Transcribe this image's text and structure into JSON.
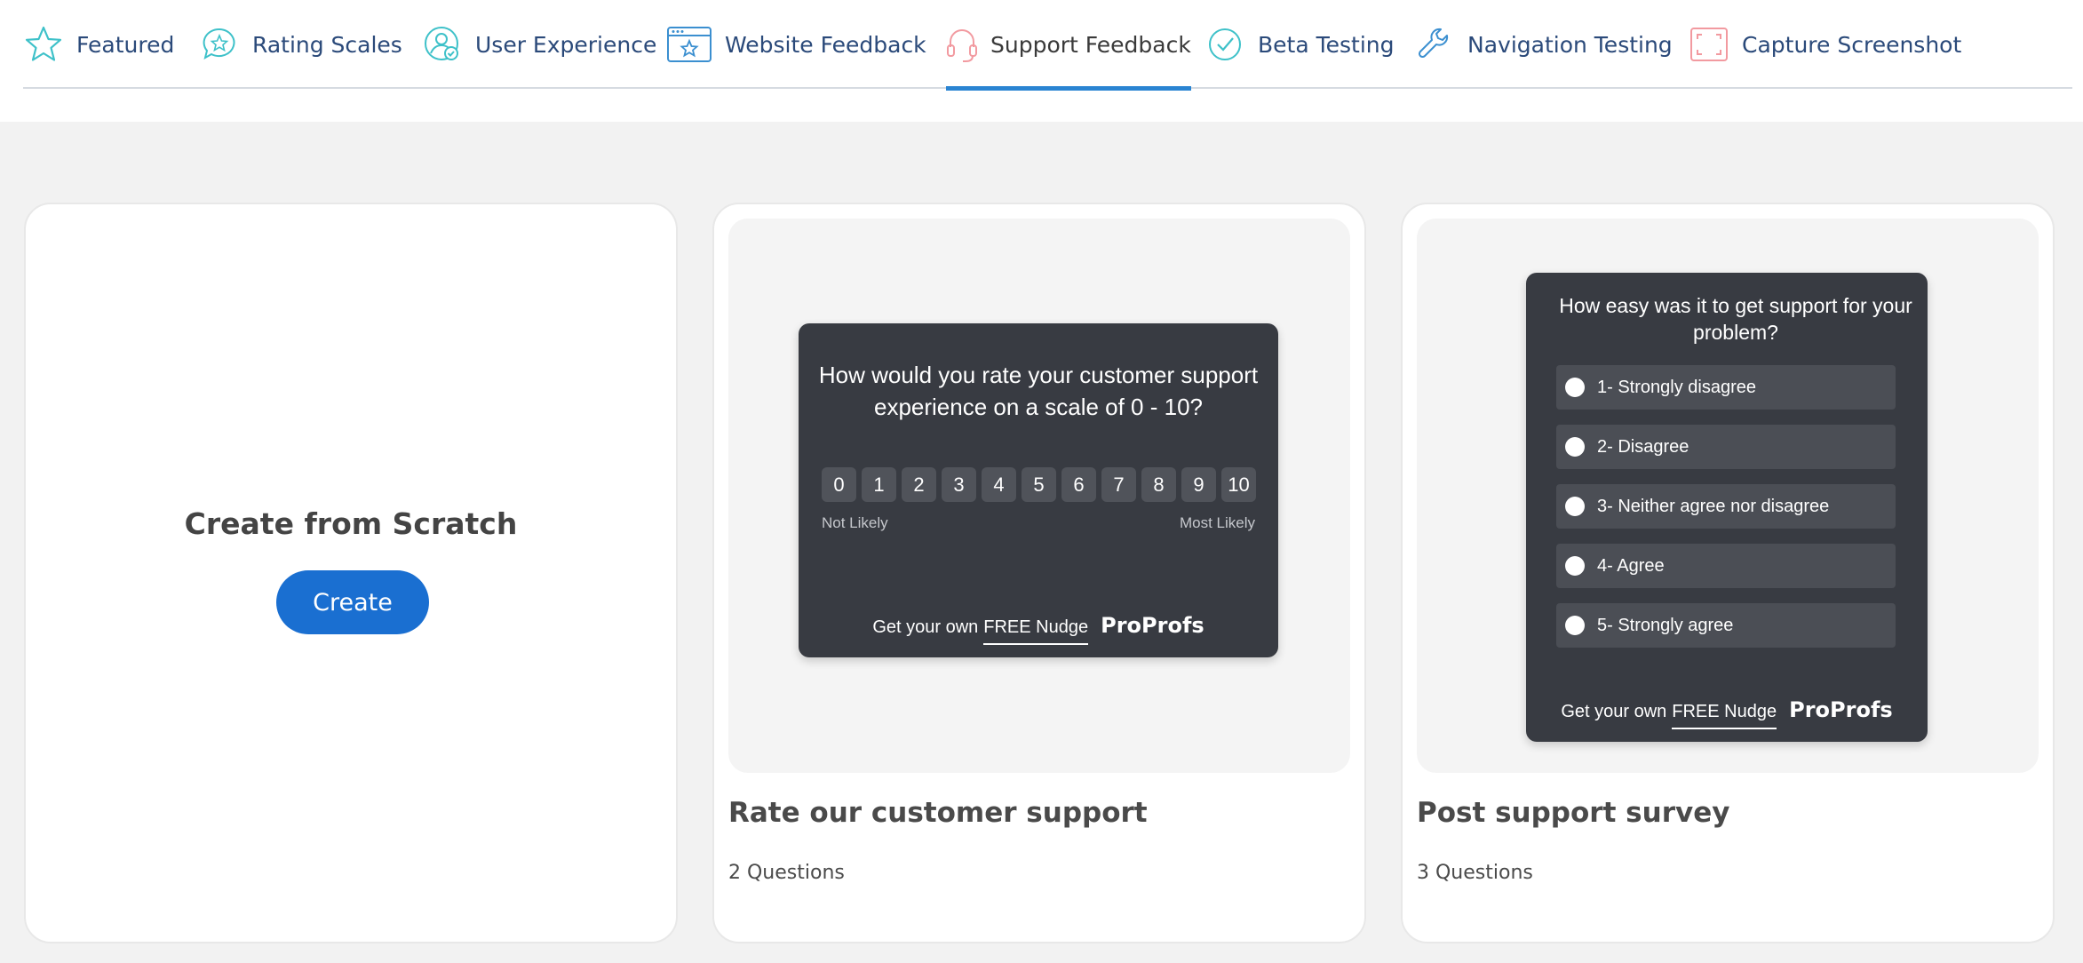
{
  "tabs": [
    {
      "label": "Featured",
      "icon": "star-icon"
    },
    {
      "label": "Rating Scales",
      "icon": "rating-bubble-icon"
    },
    {
      "label": "User Experience",
      "icon": "user-check-icon"
    },
    {
      "label": "Website Feedback",
      "icon": "browser-star-icon"
    },
    {
      "label": "Support Feedback",
      "icon": "headset-icon",
      "active": true
    },
    {
      "label": "Beta Testing",
      "icon": "check-circle-icon"
    },
    {
      "label": "Navigation Testing",
      "icon": "wrench-icon"
    },
    {
      "label": "Capture Screenshot",
      "icon": "screenshot-frame-icon"
    }
  ],
  "colors": {
    "accent": "#2a84d2",
    "tab_text": "#2b4a7a",
    "create_button": "#1a6fd1",
    "widget_bg": "#383b42"
  },
  "scratch": {
    "title": "Create from Scratch",
    "button_label": "Create"
  },
  "rate_card": {
    "title": "Rate our customer support",
    "subtitle": "2 Questions",
    "widget": {
      "question": "How would you rate your customer support experience on a scale of 0 - 10?",
      "scale": [
        "0",
        "1",
        "2",
        "3",
        "4",
        "5",
        "6",
        "7",
        "8",
        "9",
        "10"
      ],
      "label_low": "Not Likely",
      "label_high": "Most Likely",
      "footer_text": "Get your own",
      "footer_link": "FREE Nudge",
      "brand": "ProProfs"
    }
  },
  "post_card": {
    "title": "Post support survey",
    "subtitle": "3 Questions",
    "widget": {
      "question": "How easy was it to get support for your problem?",
      "options": [
        "1- Strongly disagree",
        "2- Disagree",
        "3- Neither agree nor disagree",
        "4- Agree",
        "5- Strongly agree"
      ],
      "footer_text": "Get your own",
      "footer_link": "FREE Nudge",
      "brand": "ProProfs"
    }
  }
}
